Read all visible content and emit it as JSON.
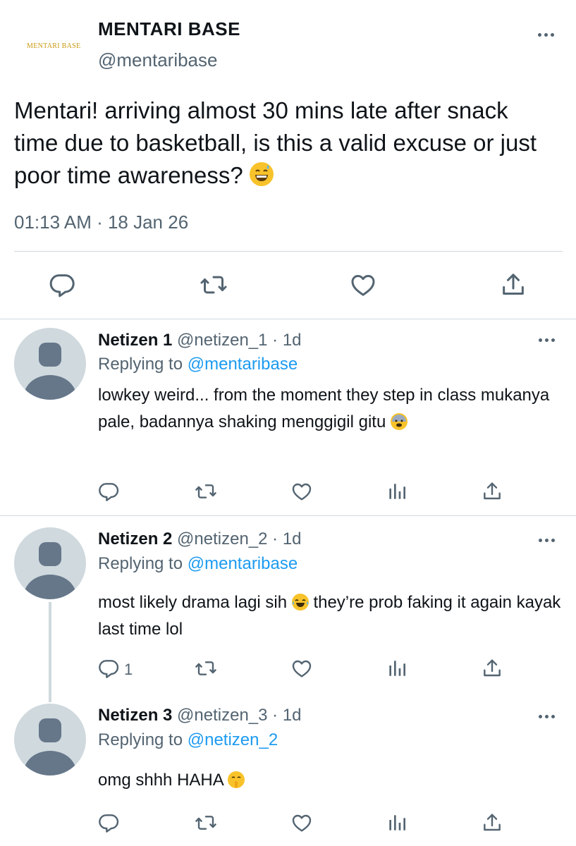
{
  "main": {
    "logo_text": "MENTARI BASE",
    "name": "MENTARI BASE",
    "handle": "@mentaribase",
    "text": "Mentari! arriving almost 30 mins late after snack time due to basketball, is this a valid excuse or just poor time awareness?",
    "emoji": "grinning-sweat-emoji",
    "timestamp": "01:13 AM · 18 Jan 26"
  },
  "replies": [
    {
      "name": "Netizen 1",
      "meta": "@netizen_1 · 1d",
      "replying_prefix": "Replying to ",
      "replying_to": "@mentaribase",
      "text": "lowkey weird... from the moment they step in class mukanya pale, badannya shaking menggigil gitu",
      "emoji": "fearful-face-emoji",
      "reply_count": ""
    },
    {
      "name": "Netizen 2",
      "meta": "@netizen_2 · 1d",
      "replying_prefix": "Replying to ",
      "replying_to": "@mentaribase",
      "text_before": "most likely drama lagi sih",
      "text_after": " they’re prob faking it again kayak last time lol",
      "emoji": "tears-of-joy-emoji",
      "reply_count": "1"
    },
    {
      "name": "Netizen 3",
      "meta": "@netizen_3 · 1d",
      "replying_prefix": "Replying to ",
      "replying_to": "@netizen_2",
      "text": "omg shhh HAHA",
      "emoji": "shushing-face-emoji",
      "reply_count": ""
    }
  ],
  "colors": {
    "text": "#0f1419",
    "secondary": "#536471",
    "link": "#1d9bf0",
    "divider": "#cfd9de",
    "avatar_bg": "#cfd9de",
    "avatar_fg": "#66778a",
    "logo": "#c99a12"
  }
}
